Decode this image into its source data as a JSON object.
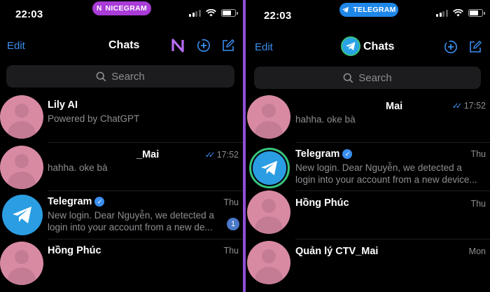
{
  "left": {
    "status": {
      "time": "22:03",
      "pill": "NICEGRAM"
    },
    "nav": {
      "edit": "Edit",
      "title": "Chats"
    },
    "search": {
      "placeholder": "Search"
    },
    "chats": [
      {
        "name": "Lily AI",
        "preview": "Powered by ChatGPT",
        "time": ""
      },
      {
        "name": "_Mai",
        "preview": "hahha. oke bà",
        "time": "17:52"
      },
      {
        "name": "Telegram",
        "preview_line1": "New login. Dear Nguyễn, we detected a",
        "preview_line2": "login into your account from a new de...",
        "time": "Thu",
        "unread": "1"
      },
      {
        "name": "Hồng Phúc",
        "preview": "",
        "time": "Thu"
      }
    ]
  },
  "right": {
    "status": {
      "time": "22:03",
      "pill": "TELEGRAM"
    },
    "nav": {
      "edit": "Edit",
      "title": "Chats"
    },
    "search": {
      "placeholder": "Search"
    },
    "chats": [
      {
        "name": "Mai",
        "preview": "hahha. oke bà",
        "time": "17:52"
      },
      {
        "name": "Telegram",
        "preview_line1": "New login. Dear Nguyễn, we detected a",
        "preview_line2": "login into your account from a new device...",
        "time": "Thu"
      },
      {
        "name": "Hồng Phúc",
        "preview": "",
        "time": "Thu"
      },
      {
        "name": "Quản lý CTV_Mai",
        "preview": "",
        "time": "Mon"
      }
    ]
  },
  "colors": {
    "accent": "#3a8ff0",
    "nicegram_pill": "#a93bd7",
    "telegram_pill": "#1f87e8",
    "divider": "#8f4fd8",
    "avatar_pink": "#d98aa3"
  },
  "icons": [
    "nicegram-logo-icon",
    "new-story-icon",
    "compose-icon",
    "search-icon",
    "verified-icon",
    "read-check-icon",
    "telegram-plane-icon",
    "wifi-icon",
    "battery-icon",
    "signal-icon"
  ]
}
